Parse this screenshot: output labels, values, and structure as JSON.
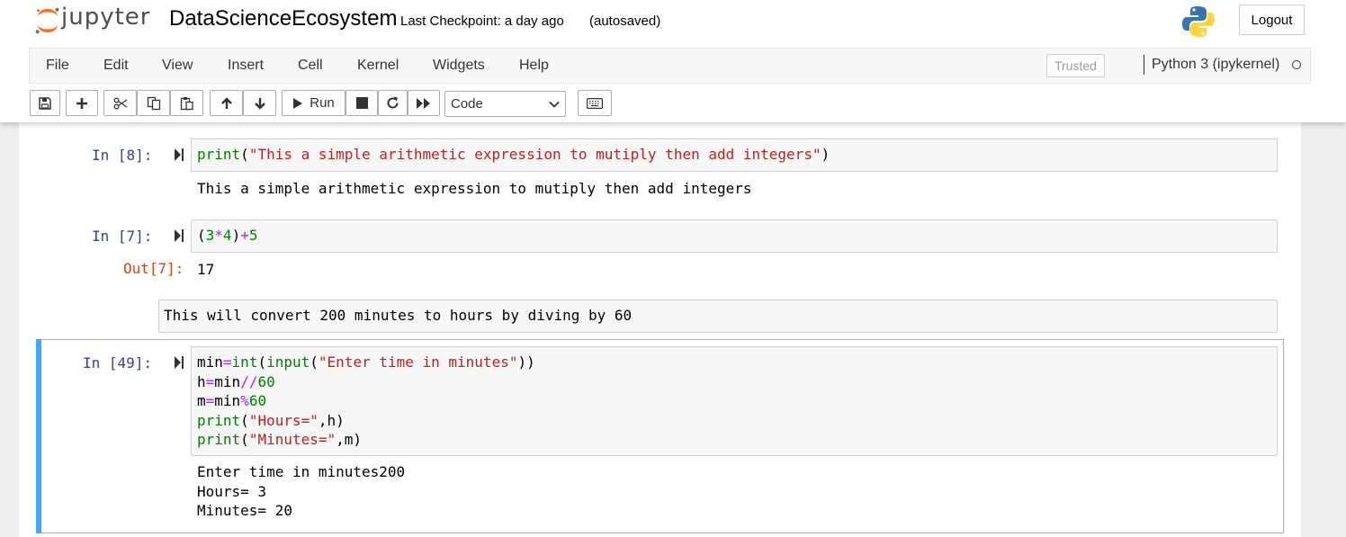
{
  "header": {
    "logo_text": "jupyter",
    "notebook_name": "DataScienceEcosystem",
    "checkpoint": "Last Checkpoint: a day ago",
    "autosave": "(autosaved)",
    "logout_label": "Logout"
  },
  "menubar": {
    "items": [
      "File",
      "Edit",
      "View",
      "Insert",
      "Cell",
      "Kernel",
      "Widgets",
      "Help"
    ],
    "trusted_label": "Trusted",
    "kernel_name": "Python 3 (ipykernel)"
  },
  "toolbar": {
    "run_label": "Run",
    "cell_type": "Code",
    "icons": [
      "save-icon",
      "plus-icon",
      "cut-icon",
      "copy-icon",
      "paste-icon",
      "arrow-up-icon",
      "arrow-down-icon",
      "play-icon",
      "stop-icon",
      "restart-icon",
      "fast-forward-icon",
      "keyboard-icon"
    ]
  },
  "cells": [
    {
      "prompt": "In [8]:",
      "code": [
        [
          [
            "k-fn",
            "print"
          ],
          [
            "k-plain",
            "("
          ],
          [
            "k-str",
            "\"This a simple arithmetic expression to mutiply then add integers\""
          ],
          [
            "k-plain",
            ")"
          ]
        ]
      ],
      "output": "This a simple arithmetic expression to mutiply then add integers"
    },
    {
      "prompt": "In [7]:",
      "code": [
        [
          [
            "k-plain",
            "("
          ],
          [
            "k-num",
            "3"
          ],
          [
            "k-op",
            "*"
          ],
          [
            "k-num",
            "4"
          ],
          [
            "k-plain",
            ")"
          ],
          [
            "k-op",
            "+"
          ],
          [
            "k-num",
            "5"
          ]
        ]
      ],
      "out_prompt": "Out[7]:",
      "output": "17"
    },
    {
      "markdown": "This will convert 200 minutes to hours by diving by 60"
    },
    {
      "prompt": "In [49]:",
      "code": [
        [
          [
            "k-plain",
            "min"
          ],
          [
            "k-op",
            "="
          ],
          [
            "k-fn",
            "int"
          ],
          [
            "k-plain",
            "("
          ],
          [
            "k-fn",
            "input"
          ],
          [
            "k-plain",
            "("
          ],
          [
            "k-str",
            "\"Enter time in minutes\""
          ],
          [
            "k-plain",
            "))"
          ]
        ],
        [
          [
            "k-plain",
            "h"
          ],
          [
            "k-op",
            "="
          ],
          [
            "k-plain",
            "min"
          ],
          [
            "k-op",
            "//"
          ],
          [
            "k-num",
            "60"
          ]
        ],
        [
          [
            "k-plain",
            "m"
          ],
          [
            "k-op",
            "="
          ],
          [
            "k-plain",
            "min"
          ],
          [
            "k-op",
            "%"
          ],
          [
            "k-num",
            "60"
          ]
        ],
        [
          [
            "k-fn",
            "print"
          ],
          [
            "k-plain",
            "("
          ],
          [
            "k-str",
            "\"Hours=\""
          ],
          [
            "k-plain",
            ",h)"
          ]
        ],
        [
          [
            "k-fn",
            "print"
          ],
          [
            "k-plain",
            "("
          ],
          [
            "k-str",
            "\"Minutes=\""
          ],
          [
            "k-plain",
            ",m)"
          ]
        ]
      ],
      "output": "Enter time in minutes200\nHours= 3\nMinutes= 20"
    }
  ],
  "colors": {
    "in_prompt": "#303f9f",
    "out_prompt": "#d84315",
    "selected_bar": "#42a5f5",
    "string": "#ba2121",
    "builtin": "#008000",
    "operator": "#aa22ff"
  }
}
